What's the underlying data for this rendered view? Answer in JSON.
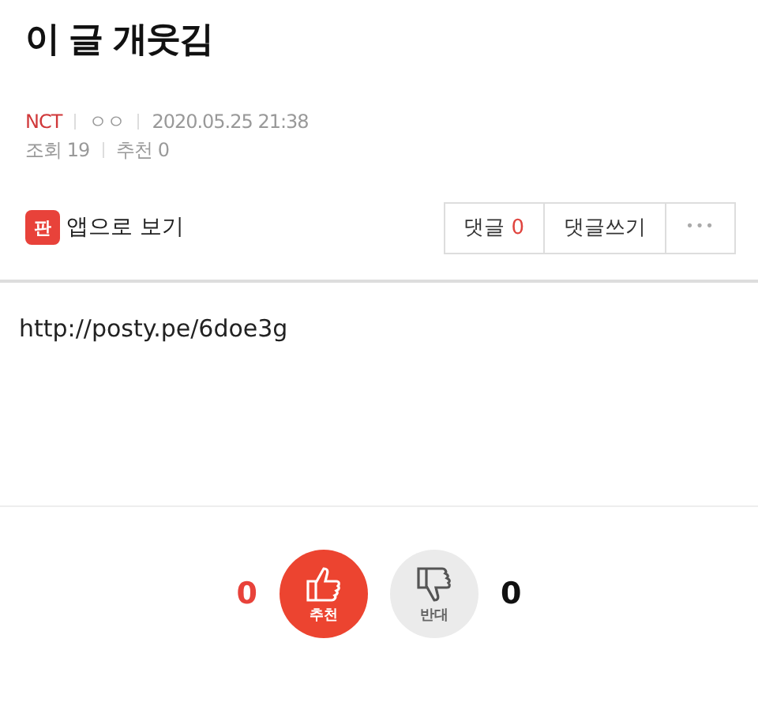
{
  "post": {
    "title": "이 글 개웃김",
    "board": "NCT",
    "author": "ㅇㅇ",
    "date": "2020.05.25 21:38",
    "views": "조회 19",
    "recommends": "추천 0"
  },
  "app_link": {
    "icon_text": "판",
    "label": "앱으로 보기"
  },
  "actions": {
    "comments_label": "댓글",
    "comments_count": "0",
    "write_label": "댓글쓰기",
    "more": "•••"
  },
  "body": "http://posty.pe/6doe3g",
  "votes": [
    {
      "kind": "up",
      "count": "0",
      "label": "추천"
    },
    {
      "kind": "down",
      "count": "0",
      "label": "반대"
    }
  ]
}
